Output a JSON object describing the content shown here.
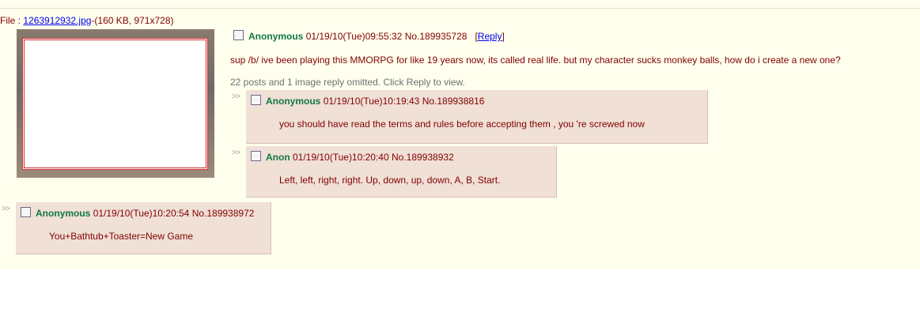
{
  "op": {
    "file_prefix": "File : ",
    "file_link": "1263912932.jpg",
    "file_info": "-(160 KB, 971x728)",
    "name": "Anonymous",
    "datetime": "01/19/10(Tue)09:55:32",
    "post_no": "No.189935728",
    "reply_open": "[",
    "reply_label": "Reply",
    "reply_close": "]",
    "message": "sup /b/ ive been playing this MMORPG for like 19 years now, its called real life. but my character sucks monkey balls, how do i create a new one?",
    "omitted": "22 posts and 1 image reply omitted. Click Reply to view."
  },
  "reply_marker": ">>",
  "replies": [
    {
      "name": "Anonymous",
      "datetime": "01/19/10(Tue)10:19:43",
      "post_no": "No.189938816",
      "message": "you should have read the terms and rules before accepting them , you 're screwed now"
    },
    {
      "name": "Anon",
      "datetime": "01/19/10(Tue)10:20:40",
      "post_no": "No.189938932",
      "message": "Left, left, right, right. Up, down, up, down, A, B, Start."
    },
    {
      "name": "Anonymous",
      "datetime": "01/19/10(Tue)10:20:54",
      "post_no": "No.189938972",
      "message": "You+Bathtub+Toaster=New Game"
    }
  ],
  "colors": {
    "background": "#ffffee",
    "reply_background": "#f0e0d6",
    "name": "#117743",
    "text": "#800000",
    "link": "#0000ee"
  }
}
